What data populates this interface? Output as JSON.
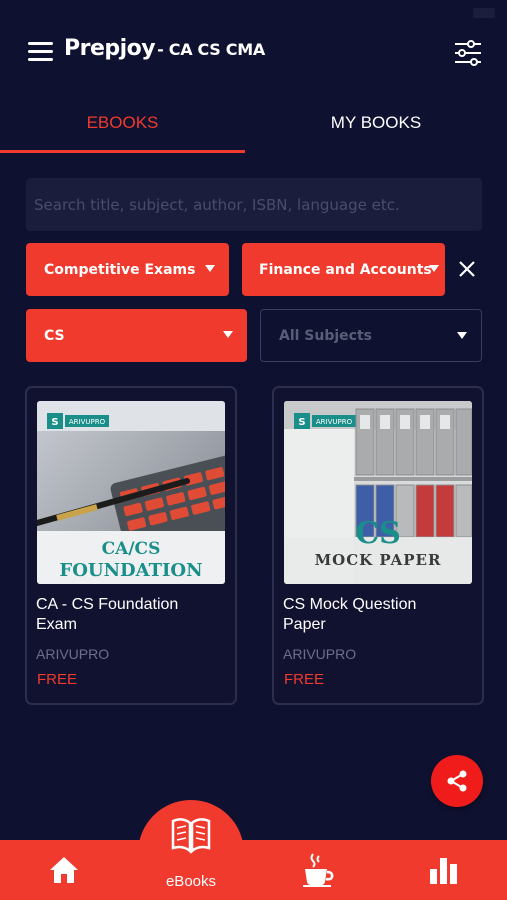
{
  "app": {
    "brand": "Prepjoy",
    "brand_suffix": "- CA CS CMA"
  },
  "tabs": [
    {
      "label": "EBOOKS",
      "active": true
    },
    {
      "label": "MY BOOKS",
      "active": false
    }
  ],
  "search": {
    "placeholder": "Search title, subject, author, ISBN, language etc.",
    "value": ""
  },
  "filters": {
    "exam": "Competitive Exams",
    "category": "Finance and Accounts",
    "course": "CS",
    "subject_placeholder": "All Subjects"
  },
  "books": [
    {
      "title": "CA - CS Foundation Exam",
      "author": "ARIVUPRO",
      "price": "FREE",
      "cover_line1": "CA/CS",
      "cover_line2": "FOUNDATION",
      "publisher_badge": "ARIVUPRO"
    },
    {
      "title": "CS Mock Question Paper",
      "author": "ARIVUPRO",
      "price": "FREE",
      "cover_line1": "CS",
      "cover_line2": "MOCK PAPER",
      "publisher_badge": "ARIVUPRO"
    }
  ],
  "bottom_nav": {
    "ebooks_label": "eBooks",
    "items": [
      {
        "icon": "home-icon"
      },
      {
        "icon": "book-open-icon"
      },
      {
        "icon": "coffee-cup-icon"
      },
      {
        "icon": "bar-chart-icon"
      }
    ]
  },
  "colors": {
    "background": "#0f1130",
    "accent": "#f03a2e",
    "card_border": "#2c2e4c"
  }
}
